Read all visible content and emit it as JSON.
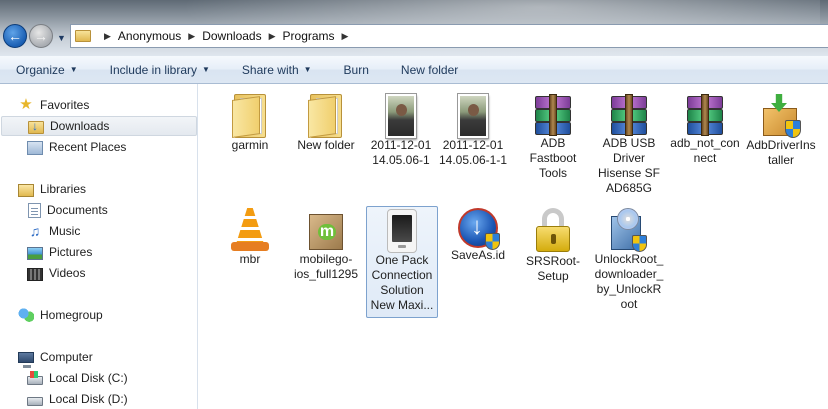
{
  "address": {
    "breadcrumbs": [
      "Anonymous",
      "Downloads",
      "Programs"
    ]
  },
  "toolbar": {
    "organize": "Organize",
    "include_in_library": "Include in library",
    "share_with": "Share with",
    "burn": "Burn",
    "new_folder": "New folder"
  },
  "nav": {
    "favorites": "Favorites",
    "downloads": "Downloads",
    "recent_places": "Recent Places",
    "libraries": "Libraries",
    "documents": "Documents",
    "music": "Music",
    "pictures": "Pictures",
    "videos": "Videos",
    "homegroup": "Homegroup",
    "computer": "Computer",
    "local_disk_c": "Local Disk (C:)",
    "local_disk_d": "Local Disk (D:)"
  },
  "files": [
    {
      "label": "garmin",
      "icon": "folder-icon"
    },
    {
      "label": "New folder",
      "icon": "folder-icon"
    },
    {
      "label": "2011-12-01 14.05.06-1",
      "icon": "photo-icon"
    },
    {
      "label": "2011-12-01 14.05.06-1-1",
      "icon": "photo-icon"
    },
    {
      "label": "ADB Fastboot Tools",
      "icon": "winrar-archive-icon"
    },
    {
      "label": "ADB USB Driver Hisense SF AD685G",
      "icon": "winrar-archive-icon"
    },
    {
      "label": "adb_not_connect",
      "icon": "winrar-archive-icon"
    },
    {
      "label": "AdbDriverInstaller",
      "icon": "installer-icon"
    },
    {
      "label": "mbr",
      "icon": "vlc-icon"
    },
    {
      "label": "mobilego-ios_full1295",
      "icon": "mobilego-icon"
    },
    {
      "label": "One Pack Connection Solution New Maxi...",
      "icon": "phone-icon"
    },
    {
      "label": "SaveAs.id",
      "icon": "saveas-icon"
    },
    {
      "label": "SRSRoot-Setup",
      "icon": "lock-icon"
    },
    {
      "label": "UnlockRoot_downloader_by_UnlockRoot",
      "icon": "unlockroot-installer-icon"
    }
  ]
}
